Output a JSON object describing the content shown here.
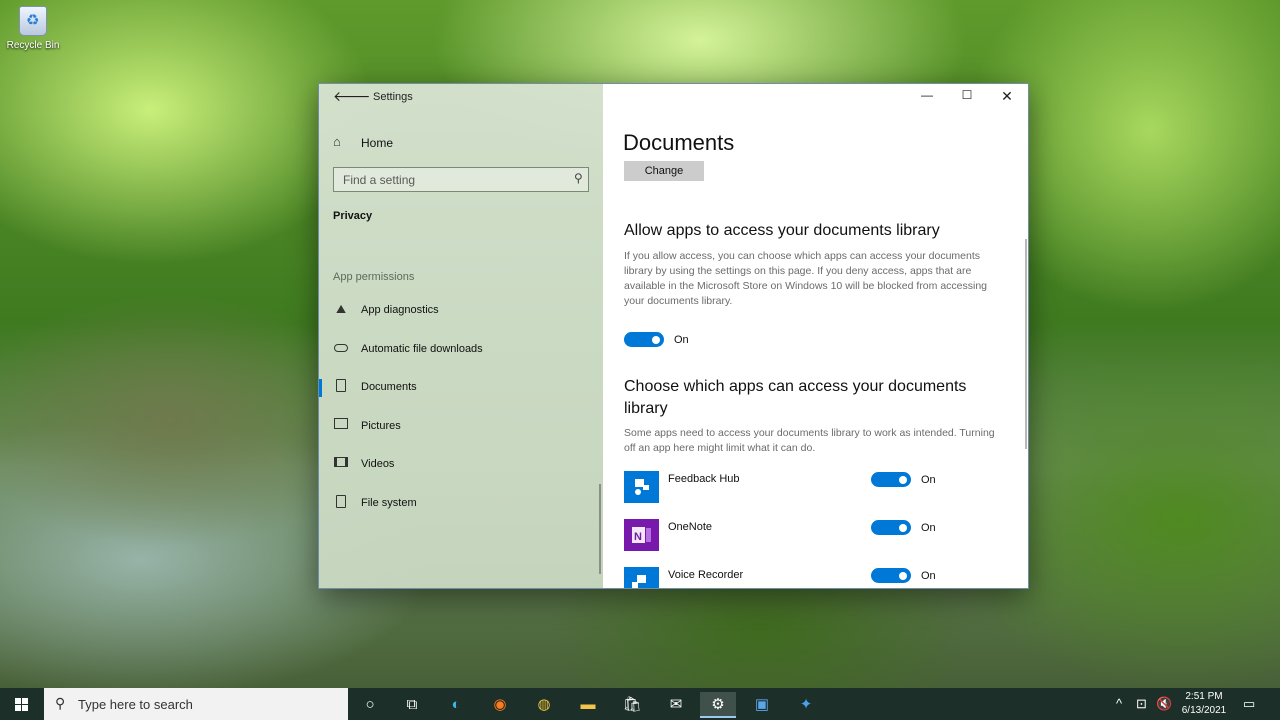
{
  "desktop": {
    "recycle_bin_label": "Recycle Bin"
  },
  "window": {
    "title": "Settings",
    "sidebar": {
      "home_label": "Home",
      "search_placeholder": "Find a setting",
      "category": "Privacy",
      "group_label": "App permissions",
      "items": [
        {
          "label": "App diagnostics",
          "icon": "chart-icon"
        },
        {
          "label": "Automatic file downloads",
          "icon": "cloud-icon"
        },
        {
          "label": "Documents",
          "icon": "document-icon",
          "active": true
        },
        {
          "label": "Pictures",
          "icon": "picture-icon"
        },
        {
          "label": "Videos",
          "icon": "video-icon"
        },
        {
          "label": "File system",
          "icon": "file-icon"
        }
      ]
    },
    "main": {
      "page_title": "Documents",
      "change_button": "Change",
      "allow_heading": "Allow apps to access your documents library",
      "allow_description": "If you allow access, you can choose which apps can access your documents library by using the settings on this page. If you deny access, apps that are available in the Microsoft Store on Windows 10 will be blocked from accessing your documents library.",
      "allow_toggle_label": "On",
      "choose_heading": "Choose which apps can access your documents library",
      "choose_description": "Some apps need to access your documents library to work as intended. Turning off an app here might limit what it can do.",
      "apps": [
        {
          "name": "Feedback Hub",
          "state": "On",
          "color": "#0078d7"
        },
        {
          "name": "OneNote",
          "state": "On",
          "color": "#7719aa"
        },
        {
          "name": "Voice Recorder",
          "state": "On",
          "color": "#0078d7"
        }
      ]
    },
    "accent_color": "#0078d7"
  },
  "taskbar": {
    "search_placeholder": "Type here to search",
    "clock_time": "2:51 PM",
    "clock_date": "6/13/2021"
  }
}
